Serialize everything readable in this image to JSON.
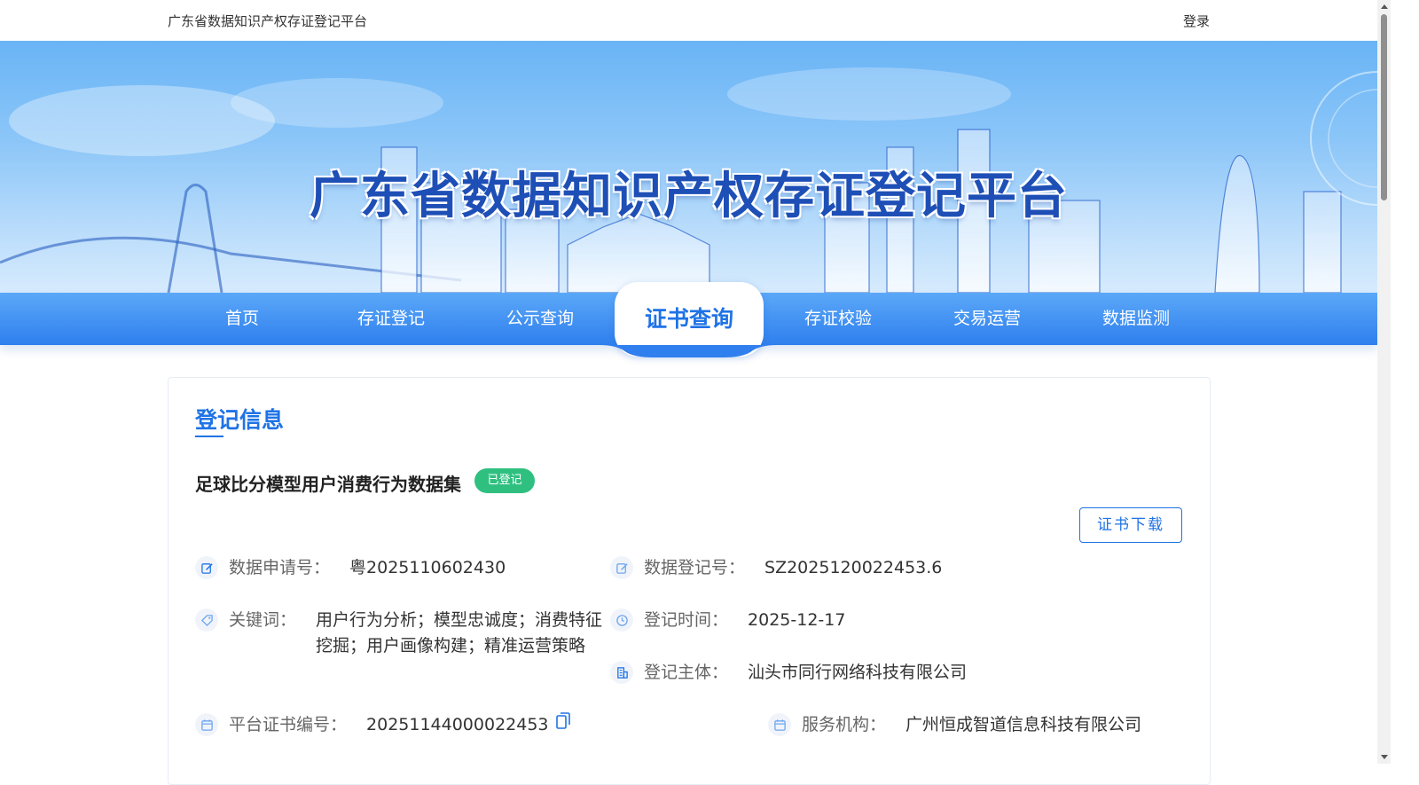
{
  "topbar": {
    "site_name": "广东省数据知识产权存证登记平台",
    "login": "登录"
  },
  "banner": {
    "title": "广东省数据知识产权存证登记平台"
  },
  "nav": {
    "items": [
      {
        "label": "首页"
      },
      {
        "label": "存证登记"
      },
      {
        "label": "公示查询"
      },
      {
        "label": "证书查询"
      },
      {
        "label": "存证校验"
      },
      {
        "label": "交易运营"
      },
      {
        "label": "数据监测"
      }
    ],
    "active": "证书查询"
  },
  "card": {
    "section_title": "登记信息",
    "dataset_name": "足球比分模型用户消费行为数据集",
    "status_badge": "已登记",
    "download_button": "证书下载",
    "fields": {
      "application_no": {
        "label": "数据申请号：",
        "value": "粤2025110602430"
      },
      "registration_no": {
        "label": "数据登记号：",
        "value": "SZ2025120022453.6"
      },
      "keywords": {
        "label": "关键词：",
        "value": "用户行为分析；模型忠诚度；消费特征挖掘；用户画像构建；精准运营策略"
      },
      "registration_time": {
        "label": "登记时间：",
        "value": "2025-12-17"
      },
      "registrant": {
        "label": "登记主体：",
        "value": "汕头市同行网络科技有限公司"
      },
      "certificate_no": {
        "label": "平台证书编号：",
        "value": "20251144000022453"
      },
      "service_agency": {
        "label": "服务机构：",
        "value": "广州恒成智道信息科技有限公司"
      }
    }
  },
  "colors": {
    "primary": "#1f73e6",
    "badge_green": "#2fc080",
    "nav_top": "#5ba8f8",
    "nav_bottom": "#2f7fee"
  }
}
